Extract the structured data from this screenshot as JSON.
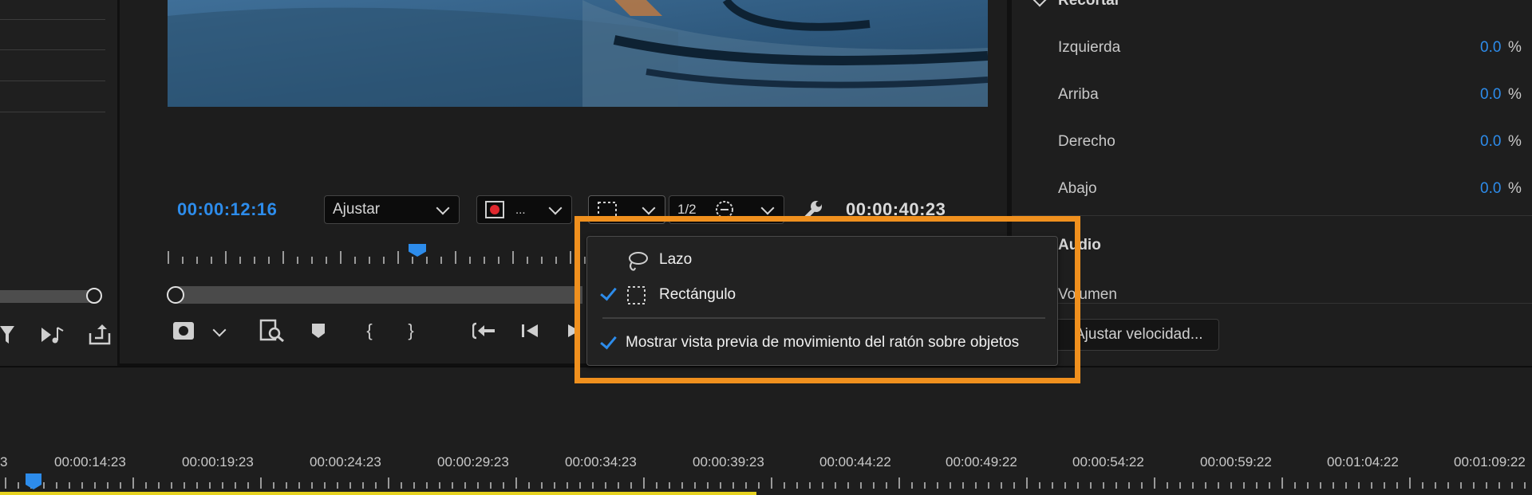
{
  "monitor": {
    "current_timecode": "00:00:12:16",
    "duration_timecode": "00:00:40:23",
    "fit_dropdown_label": "Ajustar",
    "record_dropdown_label": "...",
    "resolution_label": "1/2"
  },
  "properties": {
    "section_header": "Recortar",
    "rows": [
      {
        "label": "Izquierda",
        "value": "0.0",
        "unit": "%"
      },
      {
        "label": "Arriba",
        "value": "0.0",
        "unit": "%"
      },
      {
        "label": "Derecho",
        "value": "0.0",
        "unit": "%"
      },
      {
        "label": "Abajo",
        "value": "0.0",
        "unit": "%"
      }
    ],
    "audio_section": "Audio",
    "volume_label": "Volumen",
    "speed_button": "Ajustar velocidad..."
  },
  "menu": {
    "items": [
      {
        "label": "Lazo",
        "checked": false,
        "icon": "lasso-icon"
      },
      {
        "label": "Rectángulo",
        "checked": true,
        "icon": "rectangle-select-icon"
      },
      {
        "label": "Mostrar vista previa de movimiento del ratón sobre objetos",
        "checked": true
      }
    ]
  },
  "timeline": {
    "labels": [
      "3",
      "00:00:14:23",
      "00:00:19:23",
      "00:00:24:23",
      "00:00:29:23",
      "00:00:34:23",
      "00:00:39:23",
      "00:00:44:22",
      "00:00:49:22",
      "00:00:54:22",
      "00:00:59:22",
      "00:01:04:22",
      "00:01:09:22"
    ]
  },
  "colors": {
    "accent": "#2d8ceb",
    "highlight": "#f0901e",
    "timeline_bar": "#e6d21f"
  }
}
